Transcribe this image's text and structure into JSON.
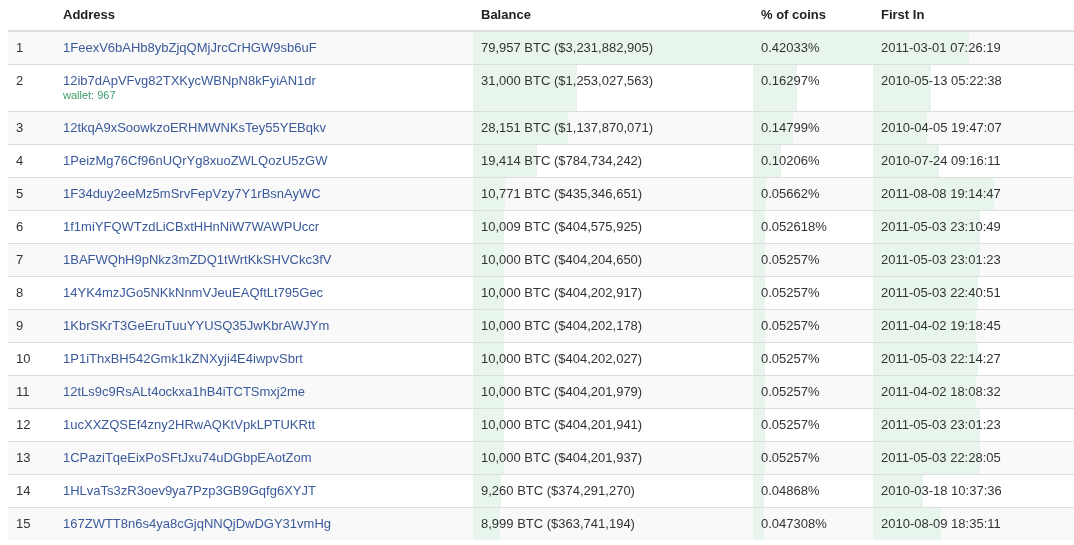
{
  "table": {
    "columns": [
      "",
      "Address",
      "Balance",
      "% of coins",
      "First In"
    ],
    "rows": [
      {
        "rank": "1",
        "address": "1FeexV6bAHb8ybZjqQMjJrcCrHGW9sb6uF",
        "balance": {
          "text": "79,957 BTC ($3,231,882,905)",
          "level": 1
        },
        "share": {
          "text": "0.42033%",
          "level": 1
        },
        "first_in": {
          "text": "2011-03-01 07:26:19",
          "level": 0.48
        }
      },
      {
        "rank": "2",
        "address": "12ib7dApVFvg82TXKycWBNpN8kFyiAN1dr",
        "wallet": "wallet: 967",
        "balance": {
          "text": "31,000 BTC ($1,253,027,563)",
          "level": 0.37
        },
        "share": {
          "text": "0.16297%",
          "level": 0.37
        },
        "first_in": {
          "text": "2010-05-13 05:22:38",
          "level": 0.29
        }
      },
      {
        "rank": "3",
        "address": "12tkqA9xSoowkzoERHMWNKsTey55YEBqkv",
        "balance": {
          "text": "28,151 BTC ($1,137,870,071)",
          "level": 0.34
        },
        "share": {
          "text": "0.14799%",
          "level": 0.33
        },
        "first_in": {
          "text": "2010-04-05 19:47:07",
          "level": 0.27
        }
      },
      {
        "rank": "4",
        "address": "1PeizMg76Cf96nUQrYg8xuoZWLQozU5zGW",
        "balance": {
          "text": "19,414 BTC ($784,734,242)",
          "level": 0.23
        },
        "share": {
          "text": "0.10206%",
          "level": 0.23
        },
        "first_in": {
          "text": "2010-07-24 09:16:11",
          "level": 0.33
        }
      },
      {
        "rank": "5",
        "address": "1F34duy2eeMz5mSrvFepVzy7Y1rBsnAyWC",
        "balance": {
          "text": "10,771 BTC ($435,346,651)",
          "level": 0.115
        },
        "share": {
          "text": "0.05662%",
          "level": 0.11
        },
        "first_in": {
          "text": "2011-08-08 19:14:47",
          "level": 0.6
        }
      },
      {
        "rank": "6",
        "address": "1f1miYFQWTzdLiCBxtHHnNiW7WAWPUccr",
        "balance": {
          "text": "10,009 BTC ($404,575,925)",
          "level": 0.11
        },
        "share": {
          "text": "0.052618%",
          "level": 0.1
        },
        "first_in": {
          "text": "2011-05-03 23:10:49",
          "level": 0.53
        }
      },
      {
        "rank": "7",
        "address": "1BAFWQhH9pNkz3mZDQ1tWrtKkSHVCkc3fV",
        "balance": {
          "text": "10,000 BTC ($404,204,650)",
          "level": 0.11
        },
        "share": {
          "text": "0.05257%",
          "level": 0.1
        },
        "first_in": {
          "text": "2011-05-03 23:01:23",
          "level": 0.53
        }
      },
      {
        "rank": "8",
        "address": "14YK4mzJGo5NKkNnmVJeuEAQftLt795Gec",
        "balance": {
          "text": "10,000 BTC ($404,202,917)",
          "level": 0.11
        },
        "share": {
          "text": "0.05257%",
          "level": 0.1
        },
        "first_in": {
          "text": "2011-05-03 22:40:51",
          "level": 0.52
        }
      },
      {
        "rank": "9",
        "address": "1KbrSKrT3GeEruTuuYYUSQ35JwKbrAWJYm",
        "balance": {
          "text": "10,000 BTC ($404,202,178)",
          "level": 0.11
        },
        "share": {
          "text": "0.05257%",
          "level": 0.1
        },
        "first_in": {
          "text": "2011-04-02 19:18:45",
          "level": 0.51
        }
      },
      {
        "rank": "10",
        "address": "1P1iThxBH542Gmk1kZNXyji4E4iwpvSbrt",
        "balance": {
          "text": "10,000 BTC ($404,202,027)",
          "level": 0.11
        },
        "share": {
          "text": "0.05257%",
          "level": 0.1
        },
        "first_in": {
          "text": "2011-05-03 22:14:27",
          "level": 0.52
        }
      },
      {
        "rank": "11",
        "address": "12tLs9c9RsALt4ockxa1hB4iTCTSmxj2me",
        "balance": {
          "text": "10,000 BTC ($404,201,979)",
          "level": 0.11
        },
        "share": {
          "text": "0.05257%",
          "level": 0.1
        },
        "first_in": {
          "text": "2011-04-02 18:08:32",
          "level": 0.51
        }
      },
      {
        "rank": "12",
        "address": "1ucXXZQSEf4zny2HRwAQKtVpkLPTUKRtt",
        "balance": {
          "text": "10,000 BTC ($404,201,941)",
          "level": 0.11
        },
        "share": {
          "text": "0.05257%",
          "level": 0.1
        },
        "first_in": {
          "text": "2011-05-03 23:01:23",
          "level": 0.53
        }
      },
      {
        "rank": "13",
        "address": "1CPaziTqeEixPoSFtJxu74uDGbpEAotZom",
        "balance": {
          "text": "10,000 BTC ($404,201,937)",
          "level": 0.11
        },
        "share": {
          "text": "0.05257%",
          "level": 0.1
        },
        "first_in": {
          "text": "2011-05-03 22:28:05",
          "level": 0.53
        }
      },
      {
        "rank": "14",
        "address": "1HLvaTs3zR3oev9ya7Pzp3GB9Gqfg6XYJT",
        "balance": {
          "text": "9,260 BTC ($374,291,270)",
          "level": 0.1
        },
        "share": {
          "text": "0.04868%",
          "level": 0.09
        },
        "first_in": {
          "text": "2010-03-18 10:37:36",
          "level": 0.25
        }
      },
      {
        "rank": "15",
        "address": "167ZWTT8n6s4ya8cGjqNNQjDwDGY31vmHg",
        "balance": {
          "text": "8,999 BTC ($363,741,194)",
          "level": 0.095
        },
        "share": {
          "text": "0.047308%",
          "level": 0.09
        },
        "first_in": {
          "text": "2010-08-09 18:35:11",
          "level": 0.34
        }
      }
    ]
  }
}
